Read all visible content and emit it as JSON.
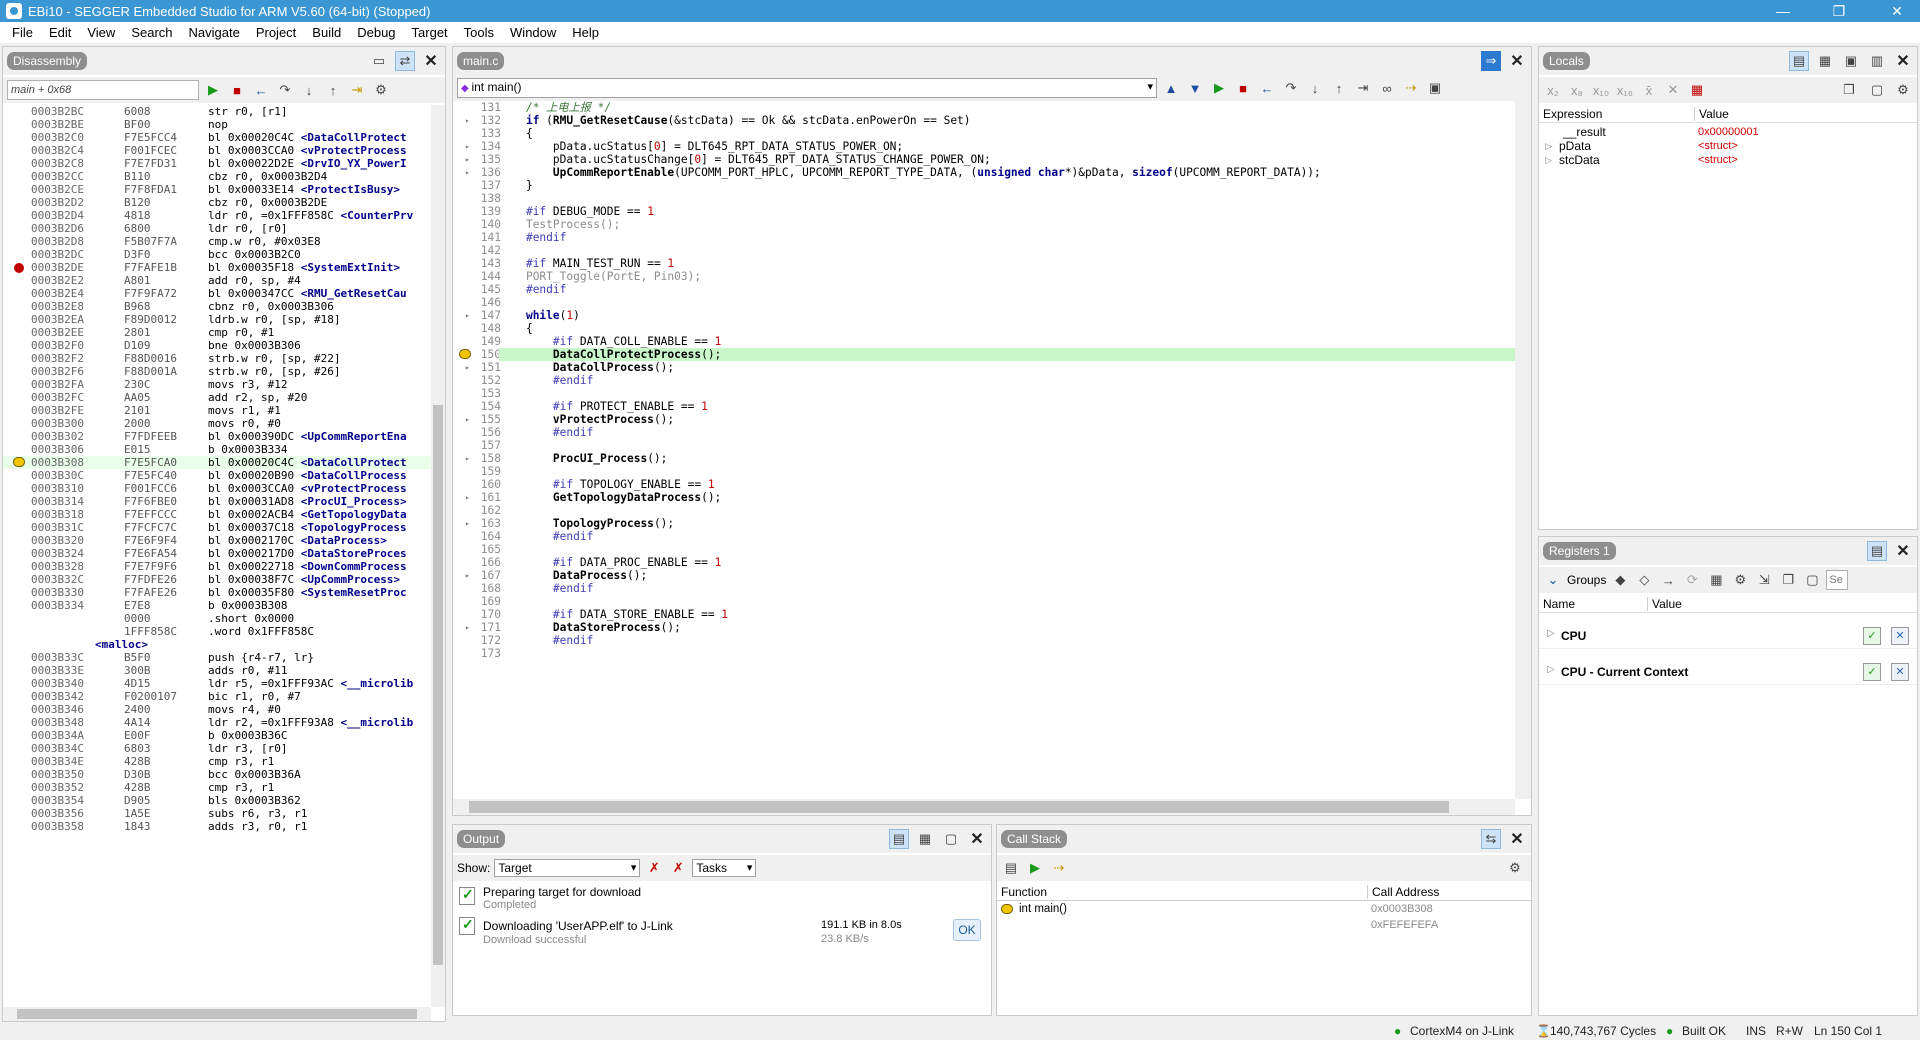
{
  "window": {
    "title": "EBi10 - SEGGER Embedded Studio for ARM V5.60 (64-bit) (Stopped)"
  },
  "menu": [
    "File",
    "Edit",
    "View",
    "Search",
    "Navigate",
    "Project",
    "Build",
    "Debug",
    "Target",
    "Tools",
    "Window",
    "Help"
  ],
  "disassembly": {
    "tab": "Disassembly",
    "location_input": "main + 0x68",
    "rows": [
      {
        "addr": "0003B2BC",
        "bytes": "6008",
        "ins": "str r0, [r1]",
        "sym": ""
      },
      {
        "addr": "0003B2BE",
        "bytes": "BF00",
        "ins": "nop",
        "sym": ""
      },
      {
        "addr": "0003B2C0",
        "bytes": "F7E5FCC4",
        "ins": "bl 0x00020C4C ",
        "sym": "<DataCollProtect"
      },
      {
        "addr": "0003B2C4",
        "bytes": "F001FCEC",
        "ins": "bl 0x0003CCA0 ",
        "sym": "<vProtectProcess"
      },
      {
        "addr": "0003B2C8",
        "bytes": "F7E7FD31",
        "ins": "bl 0x00022D2E ",
        "sym": "<DrvIO_YX_PowerI"
      },
      {
        "addr": "0003B2CC",
        "bytes": "B110",
        "ins": "cbz r0, 0x0003B2D4",
        "sym": ""
      },
      {
        "addr": "0003B2CE",
        "bytes": "F7F8FDA1",
        "ins": "bl 0x00033E14 ",
        "sym": "<ProtectIsBusy>"
      },
      {
        "addr": "0003B2D2",
        "bytes": "B120",
        "ins": "cbz r0, 0x0003B2DE",
        "sym": ""
      },
      {
        "addr": "0003B2D4",
        "bytes": "4818",
        "ins": "ldr r0, =0x1FFF858C ",
        "sym": "<CounterPrv"
      },
      {
        "addr": "0003B2D6",
        "bytes": "6800",
        "ins": "ldr r0, [r0]",
        "sym": ""
      },
      {
        "addr": "0003B2D8",
        "bytes": "F5B07F7A",
        "ins": "cmp.w r0, #0x03E8",
        "sym": ""
      },
      {
        "addr": "0003B2DC",
        "bytes": "D3F0",
        "ins": "bcc 0x0003B2C0",
        "sym": ""
      },
      {
        "addr": "0003B2DE",
        "bytes": "F7FAFE1B",
        "ins": "bl 0x00035F18 ",
        "sym": "<SystemExtInit>",
        "marker": "bp"
      },
      {
        "addr": "0003B2E2",
        "bytes": "A801",
        "ins": "add r0, sp, #4",
        "sym": ""
      },
      {
        "addr": "0003B2E4",
        "bytes": "F7F9FA72",
        "ins": "bl 0x000347CC ",
        "sym": "<RMU_GetResetCau"
      },
      {
        "addr": "0003B2E8",
        "bytes": "B968",
        "ins": "cbnz r0, 0x0003B306",
        "sym": ""
      },
      {
        "addr": "0003B2EA",
        "bytes": "F89D0012",
        "ins": "ldrb.w r0, [sp, #18]",
        "sym": ""
      },
      {
        "addr": "0003B2EE",
        "bytes": "2801",
        "ins": "cmp r0, #1",
        "sym": ""
      },
      {
        "addr": "0003B2F0",
        "bytes": "D109",
        "ins": "bne 0x0003B306",
        "sym": ""
      },
      {
        "addr": "0003B2F2",
        "bytes": "F88D0016",
        "ins": "strb.w r0, [sp, #22]",
        "sym": ""
      },
      {
        "addr": "0003B2F6",
        "bytes": "F88D001A",
        "ins": "strb.w r0, [sp, #26]",
        "sym": ""
      },
      {
        "addr": "0003B2FA",
        "bytes": "230C",
        "ins": "movs r3, #12",
        "sym": ""
      },
      {
        "addr": "0003B2FC",
        "bytes": "AA05",
        "ins": "add r2, sp, #20",
        "sym": ""
      },
      {
        "addr": "0003B2FE",
        "bytes": "2101",
        "ins": "movs r1, #1",
        "sym": ""
      },
      {
        "addr": "0003B300",
        "bytes": "2000",
        "ins": "movs r0, #0",
        "sym": ""
      },
      {
        "addr": "0003B302",
        "bytes": "F7FDFEEB",
        "ins": "bl 0x000390DC ",
        "sym": "<UpCommReportEna"
      },
      {
        "addr": "0003B306",
        "bytes": "E015",
        "ins": "b 0x0003B334",
        "sym": ""
      },
      {
        "addr": "0003B308",
        "bytes": "F7E5FCA0",
        "ins": "bl 0x00020C4C ",
        "sym": "<DataCollProtect",
        "marker": "pc"
      },
      {
        "addr": "0003B30C",
        "bytes": "F7E5FC40",
        "ins": "bl 0x00020B90 ",
        "sym": "<DataCollProcess"
      },
      {
        "addr": "0003B310",
        "bytes": "F001FCC6",
        "ins": "bl 0x0003CCA0 ",
        "sym": "<vProtectProcess"
      },
      {
        "addr": "0003B314",
        "bytes": "F7F6FBE0",
        "ins": "bl 0x00031AD8 ",
        "sym": "<ProcUI_Process>"
      },
      {
        "addr": "0003B318",
        "bytes": "F7EFFCCC",
        "ins": "bl 0x0002ACB4 ",
        "sym": "<GetTopologyData"
      },
      {
        "addr": "0003B31C",
        "bytes": "F7FCFC7C",
        "ins": "bl 0x00037C18 ",
        "sym": "<TopologyProcess"
      },
      {
        "addr": "0003B320",
        "bytes": "F7E6F9F4",
        "ins": "bl 0x0002170C ",
        "sym": "<DataProcess>"
      },
      {
        "addr": "0003B324",
        "bytes": "F7E6FA54",
        "ins": "bl 0x000217D0 ",
        "sym": "<DataStoreProces"
      },
      {
        "addr": "0003B328",
        "bytes": "F7E7F9F6",
        "ins": "bl 0x00022718 ",
        "sym": "<DownCommProcess"
      },
      {
        "addr": "0003B32C",
        "bytes": "F7FDFE26",
        "ins": "bl 0x00038F7C ",
        "sym": "<UpCommProcess>"
      },
      {
        "addr": "0003B330",
        "bytes": "F7FAFE26",
        "ins": "bl 0x00035F80 ",
        "sym": "<SystemResetProc"
      },
      {
        "addr": "0003B334",
        "bytes": "E7E8",
        "ins": "b 0x0003B308",
        "sym": ""
      },
      {
        "addr": "",
        "bytes": "0000",
        "ins": ".short 0x0000",
        "sym": ""
      },
      {
        "addr": "",
        "bytes": "1FFF858C",
        "ins": ".word 0x1FFF858C",
        "sym": ""
      },
      {
        "label": "<malloc>"
      },
      {
        "addr": "0003B33C",
        "bytes": "B5F0",
        "ins": "push {r4-r7, lr}",
        "sym": ""
      },
      {
        "addr": "0003B33E",
        "bytes": "300B",
        "ins": "adds r0, #11",
        "sym": ""
      },
      {
        "addr": "0003B340",
        "bytes": "4D15",
        "ins": "ldr r5, =0x1FFF93AC ",
        "sym": "<__microlib"
      },
      {
        "addr": "0003B342",
        "bytes": "F0200107",
        "ins": "bic r1, r0, #7",
        "sym": ""
      },
      {
        "addr": "0003B346",
        "bytes": "2400",
        "ins": "movs r4, #0",
        "sym": ""
      },
      {
        "addr": "0003B348",
        "bytes": "4A14",
        "ins": "ldr r2, =0x1FFF93A8 ",
        "sym": "<__microlib"
      },
      {
        "addr": "0003B34A",
        "bytes": "E00F",
        "ins": "b 0x0003B36C",
        "sym": ""
      },
      {
        "addr": "0003B34C",
        "bytes": "6803",
        "ins": "ldr r3, [r0]",
        "sym": ""
      },
      {
        "addr": "0003B34E",
        "bytes": "428B",
        "ins": "cmp r3, r1",
        "sym": ""
      },
      {
        "addr": "0003B350",
        "bytes": "D30B",
        "ins": "bcc 0x0003B36A",
        "sym": ""
      },
      {
        "addr": "0003B352",
        "bytes": "428B",
        "ins": "cmp r3, r1",
        "sym": ""
      },
      {
        "addr": "0003B354",
        "bytes": "D905",
        "ins": "bls 0x0003B362",
        "sym": ""
      },
      {
        "addr": "0003B356",
        "bytes": "1A5E",
        "ins": "subs r6, r3, r1",
        "sym": ""
      },
      {
        "addr": "0003B358",
        "bytes": "1843",
        "ins": "adds r3, r0, r1",
        "sym": ""
      }
    ]
  },
  "editor": {
    "tab": "main.c",
    "function_dropdown": "int main()",
    "lines": [
      {
        "n": "131",
        "html": "    <span class=\"c\">/* 上电上报 */</span>"
      },
      {
        "n": "132",
        "html": "    <span class=\"k\">if</span> (<span class=\"fn\">RMU_GetResetCause</span>(&amp;stcData) == Ok &amp;&amp; stcData.enPowerOn == Set)",
        "g": true
      },
      {
        "n": "133",
        "html": "    {"
      },
      {
        "n": "134",
        "html": "        pData.ucStatus[<span class=\"num\">0</span>] = DLT645_RPT_DATA_STATUS_POWER_ON;",
        "g": true
      },
      {
        "n": "135",
        "html": "        pData.ucStatusChange[<span class=\"num\">0</span>] = DLT645_RPT_DATA_STATUS_CHANGE_POWER_ON;",
        "g": true
      },
      {
        "n": "136",
        "html": "        <span class=\"fn\">UpCommReportEnable</span>(UPCOMM_PORT_HPLC, UPCOMM_REPORT_TYPE_DATA, (<span class=\"k\">unsigned char</span>*)&amp;pData, <span class=\"k\">sizeof</span>(UPCOMM_REPORT_DATA));",
        "g": true
      },
      {
        "n": "137",
        "html": "    }"
      },
      {
        "n": "138",
        "html": ""
      },
      {
        "n": "139",
        "html": "    <span class=\"pp\">#if</span> DEBUG_MODE == <span class=\"num\">1</span>"
      },
      {
        "n": "140",
        "html": "    <span class=\"gr\">TestProcess();</span>"
      },
      {
        "n": "141",
        "html": "    <span class=\"pp\">#endif</span>"
      },
      {
        "n": "142",
        "html": ""
      },
      {
        "n": "143",
        "html": "    <span class=\"pp\">#if</span> MAIN_TEST_RUN == <span class=\"num\">1</span>"
      },
      {
        "n": "144",
        "html": "    <span class=\"gr\">PORT_Toggle(PortE, Pin03);</span>"
      },
      {
        "n": "145",
        "html": "    <span class=\"pp\">#endif</span>"
      },
      {
        "n": "146",
        "html": ""
      },
      {
        "n": "147",
        "html": "    <span class=\"k\">while</span>(<span class=\"num\">1</span>)",
        "g": true
      },
      {
        "n": "148",
        "html": "    {"
      },
      {
        "n": "149",
        "html": "        <span class=\"pp\">#if</span> DATA_COLL_ENABLE == <span class=\"num\">1</span>"
      },
      {
        "n": "150",
        "html": "        <span class=\"fn\">DataCollProtectProcess</span>();",
        "pc": true
      },
      {
        "n": "151",
        "html": "        <span class=\"fn\">DataCollProcess</span>();",
        "g": true
      },
      {
        "n": "152",
        "html": "        <span class=\"pp\">#endif</span>"
      },
      {
        "n": "153",
        "html": ""
      },
      {
        "n": "154",
        "html": "        <span class=\"pp\">#if</span> PROTECT_ENABLE == <span class=\"num\">1</span>"
      },
      {
        "n": "155",
        "html": "        <span class=\"fn\">vProtectProcess</span>();",
        "g": true
      },
      {
        "n": "156",
        "html": "        <span class=\"pp\">#endif</span>"
      },
      {
        "n": "157",
        "html": ""
      },
      {
        "n": "158",
        "html": "        <span class=\"fn\">ProcUI_Process</span>();",
        "g": true
      },
      {
        "n": "159",
        "html": ""
      },
      {
        "n": "160",
        "html": "        <span class=\"pp\">#if</span> TOPOLOGY_ENABLE == <span class=\"num\">1</span>"
      },
      {
        "n": "161",
        "html": "        <span class=\"fn\">GetTopologyDataProcess</span>();",
        "g": true
      },
      {
        "n": "162",
        "html": ""
      },
      {
        "n": "163",
        "html": "        <span class=\"fn\">TopologyProcess</span>();",
        "g": true
      },
      {
        "n": "164",
        "html": "        <span class=\"pp\">#endif</span>"
      },
      {
        "n": "165",
        "html": ""
      },
      {
        "n": "166",
        "html": "        <span class=\"pp\">#if</span> DATA_PROC_ENABLE == <span class=\"num\">1</span>"
      },
      {
        "n": "167",
        "html": "        <span class=\"fn\">DataProcess</span>();",
        "g": true
      },
      {
        "n": "168",
        "html": "        <span class=\"pp\">#endif</span>"
      },
      {
        "n": "169",
        "html": ""
      },
      {
        "n": "170",
        "html": "        <span class=\"pp\">#if</span> DATA_STORE_ENABLE == <span class=\"num\">1</span>"
      },
      {
        "n": "171",
        "html": "        <span class=\"fn\">DataStoreProcess</span>();",
        "g": true
      },
      {
        "n": "172",
        "html": "        <span class=\"pp\">#endif</span>"
      },
      {
        "n": "173",
        "html": ""
      }
    ]
  },
  "locals": {
    "tab": "Locals",
    "col_expression": "Expression",
    "col_value": "Value",
    "rows": [
      {
        "name": "__result",
        "value": "0x00000001",
        "expand": false
      },
      {
        "name": "pData",
        "value": "<struct>",
        "expand": true
      },
      {
        "name": "stcData",
        "value": "<struct>",
        "expand": true
      }
    ]
  },
  "registers": {
    "tab": "Registers 1",
    "groups_label": "Groups",
    "search_placeholder": "Se",
    "col_name": "Name",
    "col_value": "Value",
    "rows": [
      {
        "name": "CPU"
      },
      {
        "name": "CPU - Current Context"
      }
    ]
  },
  "output": {
    "tab": "Output",
    "show_label": "Show:",
    "show_value": "Target",
    "tasks_value": "Tasks",
    "items": [
      {
        "title": "Preparing target for download",
        "sub": "Completed",
        "size": "",
        "speed": ""
      },
      {
        "title": "Downloading 'UserAPP.elf' to J-Link",
        "sub": "Download successful",
        "size": "191.1 KB in 8.0s",
        "speed": "23.8 KB/s",
        "ok": "OK"
      }
    ]
  },
  "callstack": {
    "tab": "Call Stack",
    "col_function": "Function",
    "col_addr": "Call Address",
    "rows": [
      {
        "fn": "int main()",
        "addr": "0x0003B308"
      },
      {
        "fn": "",
        "addr": "0xFEFEFEFA"
      }
    ]
  },
  "status": {
    "target": "CortexM4 on J-Link",
    "cycles": "140,743,767 Cycles",
    "build": "Built OK",
    "ins": "INS",
    "rw": "R+W",
    "pos": "Ln 150 Col 1"
  },
  "colors": {
    "title_bar": "#3b97d3",
    "pc_line": "#c9f7c9",
    "breakpoint": "#c00000"
  }
}
